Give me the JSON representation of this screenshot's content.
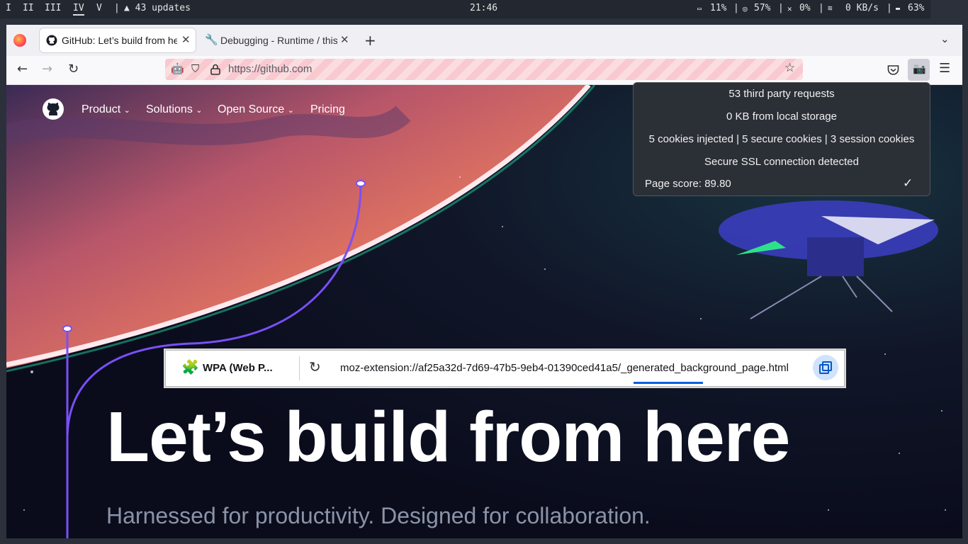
{
  "system_bar": {
    "workspaces": [
      "I",
      "II",
      "III",
      "IV",
      "V"
    ],
    "active_workspace": "IV",
    "updates": "▲ 43 updates",
    "clock": "21:46",
    "cpu": "11%",
    "memory": "57%",
    "volume": "0%",
    "network": "0 KB/s",
    "battery": "63%"
  },
  "tabs": [
    {
      "label": "GitHub: Let’s build from here",
      "icon": "github-icon"
    },
    {
      "label": "Debugging - Runtime / this-firefox",
      "icon": "wrench-icon"
    }
  ],
  "url": "https://github.com",
  "github_nav": {
    "items": [
      "Product",
      "Solutions",
      "Open Source",
      "Pricing"
    ]
  },
  "hero": {
    "title": "Let’s build from here",
    "subtitle": "Harnessed for productivity. Designed for collaboration."
  },
  "extension_popup": {
    "lines": [
      "53 third party requests",
      "0 KB from local storage",
      "5 cookies injected | 5 secure cookies | 3 session cookies",
      "Secure SSL connection detected"
    ],
    "score": "Page score: 89.80"
  },
  "debug_panel": {
    "extension_name": "WPA (Web P...",
    "url": "moz-extension://af25a32d-7d69-47b5-9eb4-01390ced41a5/_generated_background_page.html"
  },
  "colors": {
    "system_bar_bg": "#222730",
    "popup_bg": "#2b2f36",
    "page_bg": "#0d1024",
    "planet": "#e8735a",
    "accent_purple": "#7a4ff7"
  }
}
